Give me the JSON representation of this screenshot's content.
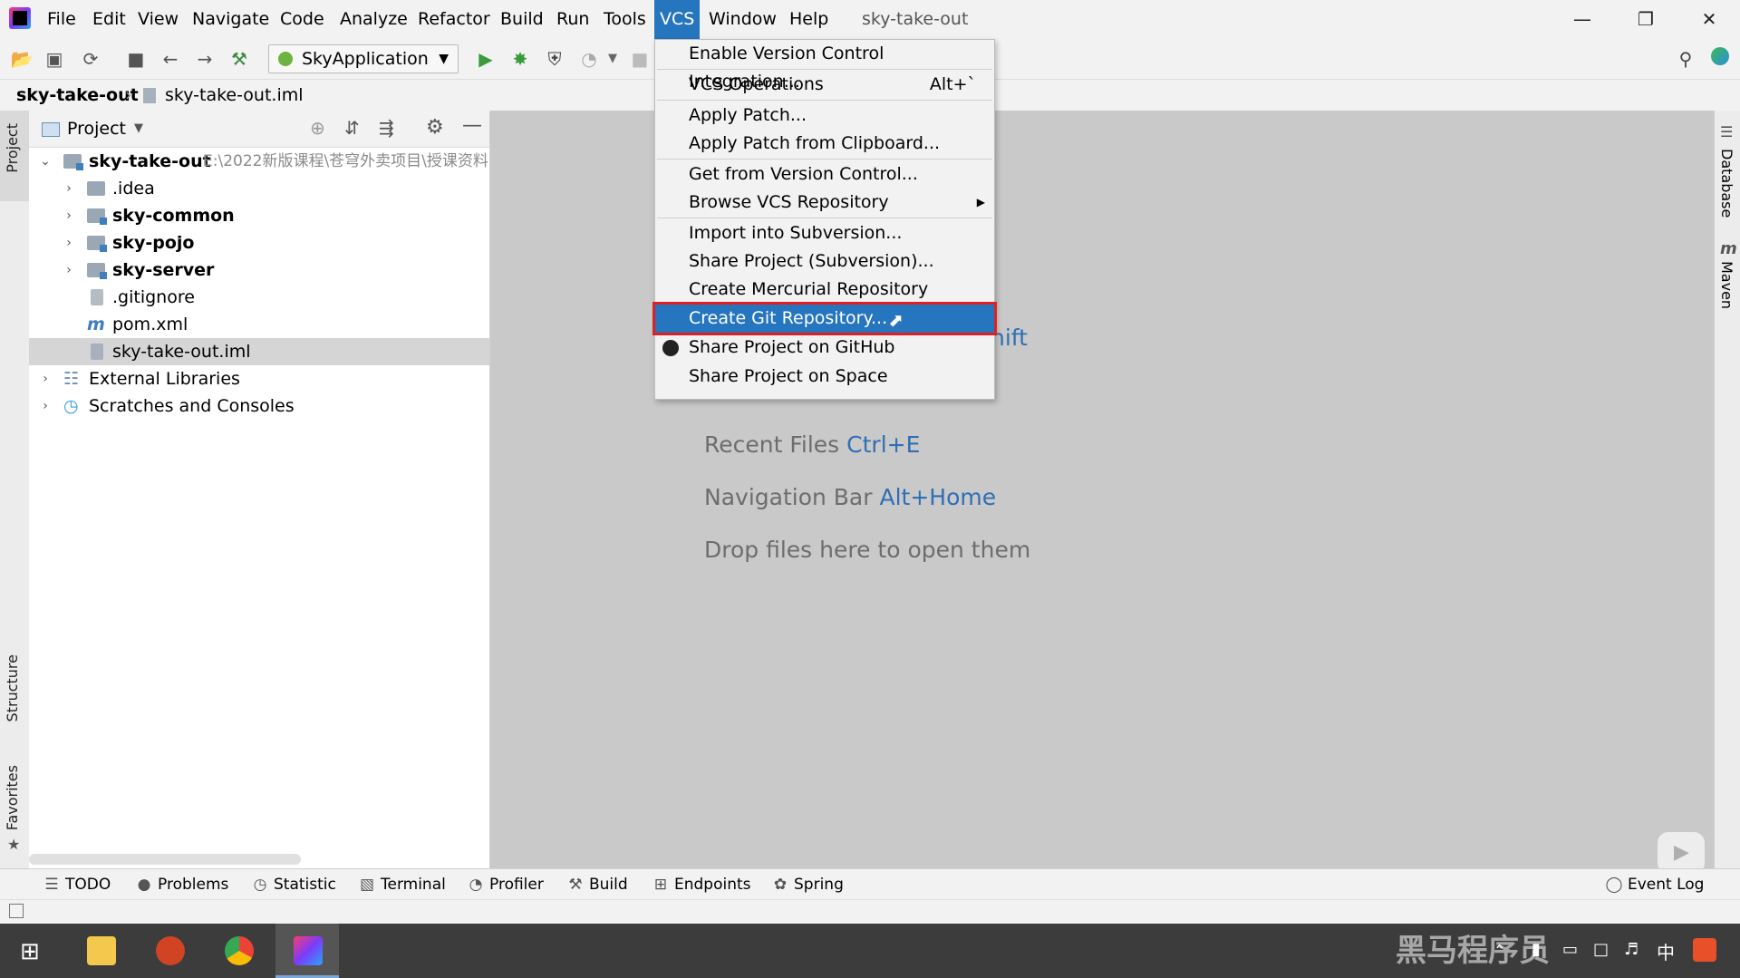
{
  "menubar": {
    "app_icon": "intellij-icon",
    "items": [
      "File",
      "Edit",
      "View",
      "Navigate",
      "Code",
      "Analyze",
      "Refactor",
      "Build",
      "Run",
      "Tools",
      "VCS",
      "Window",
      "Help"
    ],
    "active_item": "VCS",
    "title": "sky-take-out"
  },
  "toolbar": {
    "run_config": "SkyApplication"
  },
  "breadcrumb": {
    "project": "sky-take-out",
    "file": "sky-take-out.iml"
  },
  "side_tabs": {
    "left": [
      "Project",
      "Structure",
      "Favorites"
    ],
    "right": [
      "Database",
      "Maven"
    ]
  },
  "project_panel": {
    "title": "Project",
    "tree": [
      {
        "label": "sky-take-out",
        "bold": true,
        "path": "E:\\2022新版课程\\苍穹外卖项目\\授课资料"
      },
      {
        "label": ".idea"
      },
      {
        "label": "sky-common",
        "bold": true
      },
      {
        "label": "sky-pojo",
        "bold": true
      },
      {
        "label": "sky-server",
        "bold": true
      },
      {
        "label": ".gitignore"
      },
      {
        "label": "pom.xml"
      },
      {
        "label": "sky-take-out.iml",
        "selected": true
      },
      {
        "label": "External Libraries"
      },
      {
        "label": "Scratches and Consoles"
      }
    ]
  },
  "editor": {
    "partial_hint": "hift",
    "hints": [
      {
        "text": "Recent Files",
        "key": "Ctrl+E"
      },
      {
        "text": "Navigation Bar",
        "key": "Alt+Home"
      },
      {
        "text": "Drop files here to open them",
        "key": ""
      }
    ]
  },
  "vcs_menu": {
    "items": [
      {
        "label": "Enable Version Control Integration..."
      },
      {
        "label": "VCS Operations",
        "shortcut": "Alt+`"
      },
      {
        "label": "Apply Patch..."
      },
      {
        "label": "Apply Patch from Clipboard..."
      },
      {
        "label": "Get from Version Control..."
      },
      {
        "label": "Browse VCS Repository"
      },
      {
        "label": "Import into Subversion..."
      },
      {
        "label": "Share Project (Subversion)..."
      },
      {
        "label": "Create Mercurial Repository"
      },
      {
        "label": "Create Git Repository...",
        "highlighted": true
      },
      {
        "label": "Share Project on GitHub"
      },
      {
        "label": "Share Project on Space"
      }
    ]
  },
  "bottom_tools": [
    "TODO",
    "Problems",
    "Statistic",
    "Terminal",
    "Profiler",
    "Build",
    "Endpoints",
    "Spring"
  ],
  "event_log": "Event Log",
  "watermark": "黑马程序员",
  "colors": {
    "accent": "#2675bf",
    "highlight_border": "#e02020",
    "editor_bg": "#c9c9c9",
    "link_key": "#2f6fb5"
  }
}
